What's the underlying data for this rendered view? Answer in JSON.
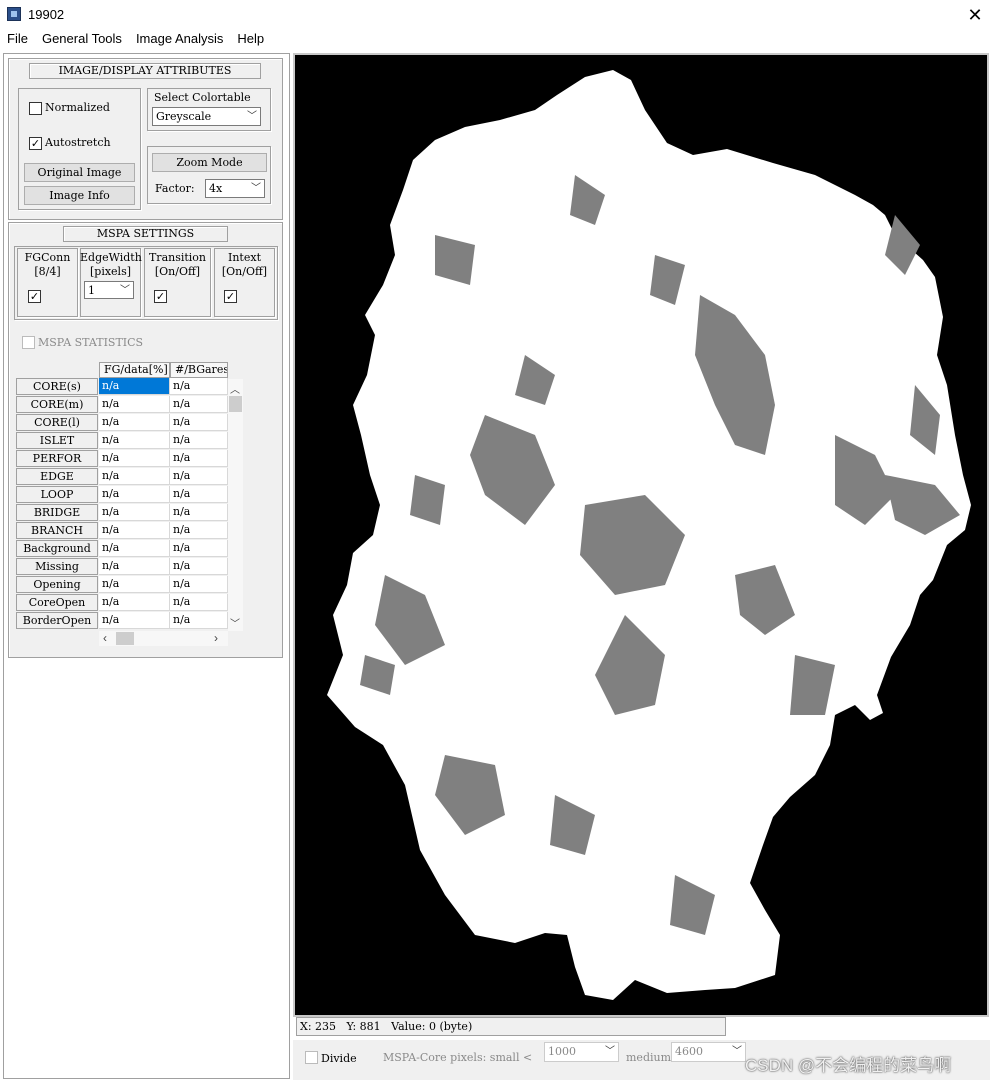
{
  "window": {
    "title": "19902"
  },
  "menu": [
    "File",
    "General Tools",
    "Image Analysis",
    "Help"
  ],
  "display": {
    "header": "IMAGE/DISPLAY ATTRIBUTES",
    "normalized_label": "Normalized",
    "normalized_checked": false,
    "autostretch_label": "Autostretch",
    "autostretch_checked": true,
    "original_image_btn": "Original Image",
    "image_info_btn": "Image Info",
    "colortable_label": "Select Colortable",
    "colortable_value": "Greyscale",
    "zoom_mode_btn": "Zoom Mode",
    "factor_label": "Factor:",
    "factor_value": "4x"
  },
  "mspa": {
    "header": "MSPA SETTINGS",
    "fgconn": {
      "line1": "FGConn",
      "line2": "[8/4]",
      "checked": true
    },
    "edgewidth": {
      "line1": "EdgeWidth",
      "line2": "[pixels]",
      "value": "1"
    },
    "transition": {
      "line1": "Transition",
      "line2": "[On/Off]",
      "checked": true
    },
    "intext": {
      "line1": "Intext",
      "line2": "[On/Off]",
      "checked": true
    }
  },
  "statistics": {
    "label": "MSPA STATISTICS",
    "checked": false,
    "columns": [
      "FG/data[%]",
      "#/BGares"
    ],
    "rows": [
      {
        "name": "CORE(s)",
        "values": [
          "n/a",
          "n/a"
        ]
      },
      {
        "name": "CORE(m)",
        "values": [
          "n/a",
          "n/a"
        ]
      },
      {
        "name": "CORE(l)",
        "values": [
          "n/a",
          "n/a"
        ]
      },
      {
        "name": "ISLET",
        "values": [
          "n/a",
          "n/a"
        ]
      },
      {
        "name": "PERFOR",
        "values": [
          "n/a",
          "n/a"
        ]
      },
      {
        "name": "EDGE",
        "values": [
          "n/a",
          "n/a"
        ]
      },
      {
        "name": "LOOP",
        "values": [
          "n/a",
          "n/a"
        ]
      },
      {
        "name": "BRIDGE",
        "values": [
          "n/a",
          "n/a"
        ]
      },
      {
        "name": "BRANCH",
        "values": [
          "n/a",
          "n/a"
        ]
      },
      {
        "name": "Background",
        "values": [
          "n/a",
          "n/a"
        ]
      },
      {
        "name": "Missing",
        "values": [
          "n/a",
          "n/a"
        ]
      },
      {
        "name": "Opening",
        "values": [
          "n/a",
          "n/a"
        ]
      },
      {
        "name": "CoreOpen",
        "values": [
          "n/a",
          "n/a"
        ]
      },
      {
        "name": "BorderOpen",
        "values": [
          "n/a",
          "n/a"
        ]
      }
    ]
  },
  "status": {
    "x_label": "X:",
    "x": "235",
    "y_label": "Y:",
    "y": "881",
    "value_label": "Value:",
    "value": "0 (byte)"
  },
  "bottom": {
    "divide_label": "Divide",
    "core_label": "MSPA-Core pixels: small <",
    "small_value": "1000",
    "medium_label": "medium",
    "medium_value": "4600"
  },
  "watermark": "CSDN @不会编程的菜鸟啊",
  "colors": {
    "map_land": "#ffffff",
    "map_forest": "#808080",
    "map_background": "#000000",
    "selection": "#0078d7"
  }
}
